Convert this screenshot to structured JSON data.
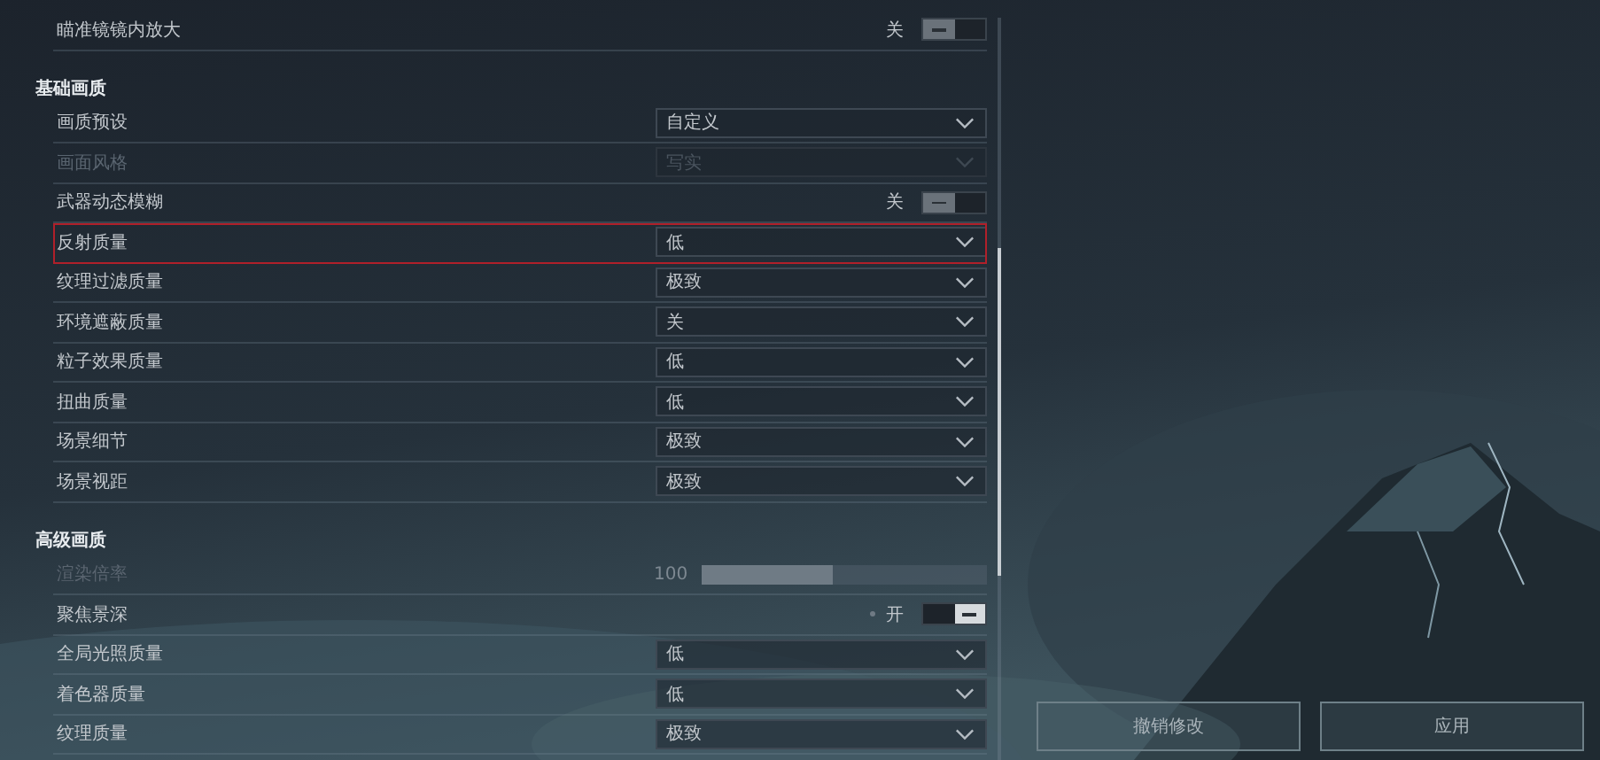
{
  "top_rows": [
    {
      "kind": "toggle",
      "label": "瞄准镜镜内放大",
      "state_text": "关",
      "on": false,
      "disabled": false,
      "highlighted": false,
      "modified": false
    }
  ],
  "sections": [
    {
      "title": "基础画质",
      "rows": [
        {
          "kind": "dropdown",
          "label": "画质预设",
          "value": "自定义",
          "disabled": false,
          "highlighted": false
        },
        {
          "kind": "dropdown",
          "label": "画面风格",
          "value": "写实",
          "disabled": true,
          "highlighted": false
        },
        {
          "kind": "toggle",
          "label": "武器动态模糊",
          "state_text": "关",
          "on": false,
          "disabled": false,
          "highlighted": false,
          "modified": false
        },
        {
          "kind": "dropdown",
          "label": "反射质量",
          "value": "低",
          "disabled": false,
          "highlighted": true
        },
        {
          "kind": "dropdown",
          "label": "纹理过滤质量",
          "value": "极致",
          "disabled": false,
          "highlighted": false
        },
        {
          "kind": "dropdown",
          "label": "环境遮蔽质量",
          "value": "关",
          "disabled": false,
          "highlighted": false
        },
        {
          "kind": "dropdown",
          "label": "粒子效果质量",
          "value": "低",
          "disabled": false,
          "highlighted": false
        },
        {
          "kind": "dropdown",
          "label": "扭曲质量",
          "value": "低",
          "disabled": false,
          "highlighted": false
        },
        {
          "kind": "dropdown",
          "label": "场景细节",
          "value": "极致",
          "disabled": false,
          "highlighted": false
        },
        {
          "kind": "dropdown",
          "label": "场景视距",
          "value": "极致",
          "disabled": false,
          "highlighted": false
        }
      ]
    },
    {
      "title": "高级画质",
      "rows": [
        {
          "kind": "slider",
          "label": "渲染倍率",
          "reading": "100",
          "level": 0.46,
          "disabled": true,
          "highlighted": false
        },
        {
          "kind": "toggle",
          "label": "聚焦景深",
          "state_text": "开",
          "on": true,
          "disabled": false,
          "highlighted": false,
          "modified": true
        },
        {
          "kind": "dropdown",
          "label": "全局光照质量",
          "value": "低",
          "disabled": false,
          "highlighted": false
        },
        {
          "kind": "dropdown",
          "label": "着色器质量",
          "value": "低",
          "disabled": false,
          "highlighted": false
        },
        {
          "kind": "dropdown",
          "label": "纹理质量",
          "value": "极致",
          "disabled": false,
          "highlighted": false
        }
      ]
    }
  ],
  "buttons": [
    "撤销修改",
    "应用"
  ]
}
